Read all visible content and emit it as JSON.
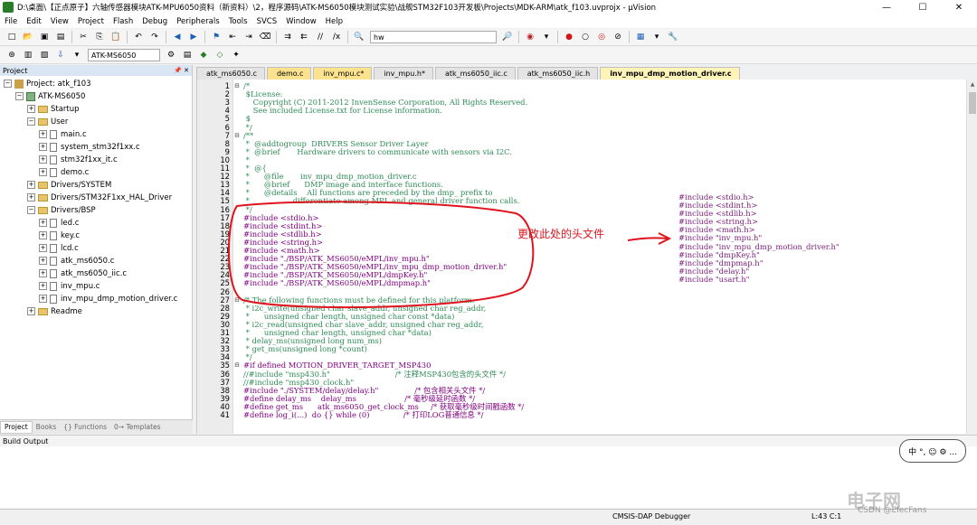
{
  "window": {
    "title": "D:\\桌面\\【正点原子】六轴传感器模块ATK-MPU6050资料（新资料）\\2，程序源码\\ATK-MS6050模块测试实验\\战舰STM32F103开发板\\Projects\\MDK-ARM\\atk_f103.uvprojx - µVision",
    "minimize": "—",
    "maximize": "☐",
    "close": "✕"
  },
  "menu": [
    "File",
    "Edit",
    "View",
    "Project",
    "Flash",
    "Debug",
    "Peripherals",
    "Tools",
    "SVCS",
    "Window",
    "Help"
  ],
  "toolbar1": {
    "find_value": "hw"
  },
  "toolbar2": {
    "target_value": "ATK-MS6050"
  },
  "project_panel": {
    "title": "Project",
    "tree": [
      {
        "label": "Project: atk_f103",
        "type": "project",
        "expander": "−",
        "depth": 0
      },
      {
        "label": "ATK-MS6050",
        "type": "target",
        "expander": "−",
        "depth": 1
      },
      {
        "label": "Startup",
        "type": "folder",
        "expander": "+",
        "depth": 2
      },
      {
        "label": "User",
        "type": "folder",
        "expander": "−",
        "depth": 2
      },
      {
        "label": "main.c",
        "type": "file",
        "expander": "+",
        "depth": 3
      },
      {
        "label": "system_stm32f1xx.c",
        "type": "file",
        "expander": "+",
        "depth": 3
      },
      {
        "label": "stm32f1xx_it.c",
        "type": "file",
        "expander": "+",
        "depth": 3
      },
      {
        "label": "demo.c",
        "type": "file",
        "expander": "+",
        "depth": 3
      },
      {
        "label": "Drivers/SYSTEM",
        "type": "folder",
        "expander": "+",
        "depth": 2
      },
      {
        "label": "Drivers/STM32F1xx_HAL_Driver",
        "type": "folder",
        "expander": "+",
        "depth": 2
      },
      {
        "label": "Drivers/BSP",
        "type": "folder",
        "expander": "−",
        "depth": 2
      },
      {
        "label": "led.c",
        "type": "file",
        "expander": "+",
        "depth": 3
      },
      {
        "label": "key.c",
        "type": "file",
        "expander": "+",
        "depth": 3
      },
      {
        "label": "lcd.c",
        "type": "file",
        "expander": "+",
        "depth": 3
      },
      {
        "label": "atk_ms6050.c",
        "type": "file",
        "expander": "+",
        "depth": 3
      },
      {
        "label": "atk_ms6050_iic.c",
        "type": "file",
        "expander": "+",
        "depth": 3
      },
      {
        "label": "inv_mpu.c",
        "type": "file",
        "expander": "+",
        "depth": 3
      },
      {
        "label": "inv_mpu_dmp_motion_driver.c",
        "type": "file",
        "expander": "+",
        "depth": 3
      },
      {
        "label": "Readme",
        "type": "folder",
        "expander": "+",
        "depth": 2
      }
    ],
    "bottom_tabs": [
      "Project",
      "Books",
      "{} Functions",
      "0→ Templates"
    ]
  },
  "editor_tabs": [
    {
      "label": "atk_ms6050.c",
      "style": "normal"
    },
    {
      "label": "demo.c",
      "style": "yellow"
    },
    {
      "label": "inv_mpu.c*",
      "style": "yellow"
    },
    {
      "label": "inv_mpu.h*",
      "style": "normal"
    },
    {
      "label": "atk_ms6050_iic.c",
      "style": "normal"
    },
    {
      "label": "atk_ms6050_iic.h",
      "style": "normal"
    },
    {
      "label": "inv_mpu_dmp_motion_driver.c",
      "style": "active"
    }
  ],
  "code": [
    {
      "n": "1",
      "fold": "⊟",
      "cls": "cmt",
      "text": "/*"
    },
    {
      "n": "2",
      "fold": "",
      "cls": "cmt",
      "text": " $License:"
    },
    {
      "n": "3",
      "fold": "",
      "cls": "cmt",
      "text": "    Copyright (C) 2011-2012 InvenSense Corporation, All Rights Reserved."
    },
    {
      "n": "4",
      "fold": "",
      "cls": "cmt",
      "text": "    See included License.txt for License information."
    },
    {
      "n": "5",
      "fold": "",
      "cls": "cmt",
      "text": " $"
    },
    {
      "n": "6",
      "fold": "",
      "cls": "cmt",
      "text": " */"
    },
    {
      "n": "7",
      "fold": "⊟",
      "cls": "cmt",
      "text": "/**"
    },
    {
      "n": "8",
      "fold": "",
      "cls": "cmt",
      "text": " *  @addtogroup  DRIVERS Sensor Driver Layer"
    },
    {
      "n": "9",
      "fold": "",
      "cls": "cmt",
      "text": " *  @brief       Hardware drivers to communicate with sensors via I2C."
    },
    {
      "n": "10",
      "fold": "",
      "cls": "cmt",
      "text": " *"
    },
    {
      "n": "11",
      "fold": "",
      "cls": "cmt",
      "text": " *  @{"
    },
    {
      "n": "12",
      "fold": "",
      "cls": "cmt",
      "text": " *      @file       inv_mpu_dmp_motion_driver.c"
    },
    {
      "n": "13",
      "fold": "",
      "cls": "cmt",
      "text": " *      @brief      DMP image and interface functions."
    },
    {
      "n": "14",
      "fold": "",
      "cls": "cmt",
      "text": " *      @details    All functions are preceded by the dmp_ prefix to"
    },
    {
      "n": "15",
      "fold": "",
      "cls": "cmt",
      "text": " *                  differentiate among MPL and general driver function calls."
    },
    {
      "n": "16",
      "fold": "",
      "cls": "cmt",
      "text": " */"
    },
    {
      "n": "17",
      "fold": "",
      "cls": "pp",
      "text": "#include <stdio.h>"
    },
    {
      "n": "18",
      "fold": "",
      "cls": "pp",
      "text": "#include <stdint.h>"
    },
    {
      "n": "19",
      "fold": "",
      "cls": "pp",
      "text": "#include <stdlib.h>"
    },
    {
      "n": "20",
      "fold": "",
      "cls": "pp",
      "text": "#include <string.h>"
    },
    {
      "n": "21",
      "fold": "",
      "cls": "pp",
      "text": "#include <math.h>"
    },
    {
      "n": "22",
      "fold": "",
      "cls": "pp",
      "text": "#include \"./BSP/ATK_MS6050/eMPL/inv_mpu.h\""
    },
    {
      "n": "23",
      "fold": "",
      "cls": "pp",
      "text": "#include \"./BSP/ATK_MS6050/eMPL/inv_mpu_dmp_motion_driver.h\""
    },
    {
      "n": "24",
      "fold": "",
      "cls": "pp",
      "text": "#include \"./BSP/ATK_MS6050/eMPL/dmpKey.h\""
    },
    {
      "n": "25",
      "fold": "",
      "cls": "pp",
      "text": "#include \"./BSP/ATK_MS6050/eMPL/dmpmap.h\""
    },
    {
      "n": "26",
      "fold": "",
      "cls": "plain",
      "text": ""
    },
    {
      "n": "27",
      "fold": "⊟",
      "cls": "cmt",
      "text": "/* The following functions must be defined for this platform:"
    },
    {
      "n": "28",
      "fold": "",
      "cls": "cmt",
      "text": " * i2c_write(unsigned char slave_addr, unsigned char reg_addr,"
    },
    {
      "n": "29",
      "fold": "",
      "cls": "cmt",
      "text": " *      unsigned char length, unsigned char const *data)"
    },
    {
      "n": "30",
      "fold": "",
      "cls": "cmt",
      "text": " * i2c_read(unsigned char slave_addr, unsigned char reg_addr,"
    },
    {
      "n": "31",
      "fold": "",
      "cls": "cmt",
      "text": " *      unsigned char length, unsigned char *data)"
    },
    {
      "n": "32",
      "fold": "",
      "cls": "cmt",
      "text": " * delay_ms(unsigned long num_ms)"
    },
    {
      "n": "33",
      "fold": "",
      "cls": "cmt",
      "text": " * get_ms(unsigned long *count)"
    },
    {
      "n": "34",
      "fold": "",
      "cls": "cmt",
      "text": " */"
    },
    {
      "n": "35",
      "fold": "⊟",
      "cls": "pp",
      "text": "#if defined MOTION_DRIVER_TARGET_MSP430"
    },
    {
      "n": "36",
      "fold": "",
      "cls": "cmt",
      "text": "//#include \"msp430.h\"                           /* 注释MSP430包含的头文件 */"
    },
    {
      "n": "37",
      "fold": "",
      "cls": "cmt",
      "text": "//#include \"msp430_clock.h\""
    },
    {
      "n": "38",
      "fold": "",
      "cls": "pp",
      "text": "#include \"./SYSTEM/delay/delay.h\"               /* 包含相关头文件 */"
    },
    {
      "n": "39",
      "fold": "",
      "cls": "pp",
      "text": "#define delay_ms    delay_ms                    /* 毫秒级延时函数 */"
    },
    {
      "n": "40",
      "fold": "",
      "cls": "pp",
      "text": "#define get_ms      atk_ms6050_get_clock_ms     /* 获取毫秒级时间戳函数 */"
    },
    {
      "n": "41",
      "fold": "",
      "cls": "pp",
      "text": "#define log_i(...)  do {} while (0)              /* 打印LOG普通信息 */"
    }
  ],
  "annotation": {
    "label": "更改此处的头文件",
    "arrow": "→",
    "color": "#e0141e",
    "includes": [
      "#include <stdio.h>",
      "#include <stdint.h>",
      "#include <stdlib.h>",
      "#include <string.h>",
      "#include <math.h>",
      "#include \"inv_mpu.h\"",
      "#include \"inv_mpu_dmp_motion_driver.h\"",
      "#include \"dmpKey.h\"",
      "#include \"dmpmap.h\"",
      "#include \"delay.h\"",
      "#include \"usart.h\""
    ]
  },
  "build_output": {
    "title": "Build Output"
  },
  "status": {
    "debugger": "CMSIS-DAP Debugger",
    "position": "L:43 C:1"
  },
  "widget": {
    "label": "中 °, ☺ ⚙ ..."
  },
  "watermark": {
    "text": "电子网",
    "sub": "CSDN @ElecFans"
  }
}
